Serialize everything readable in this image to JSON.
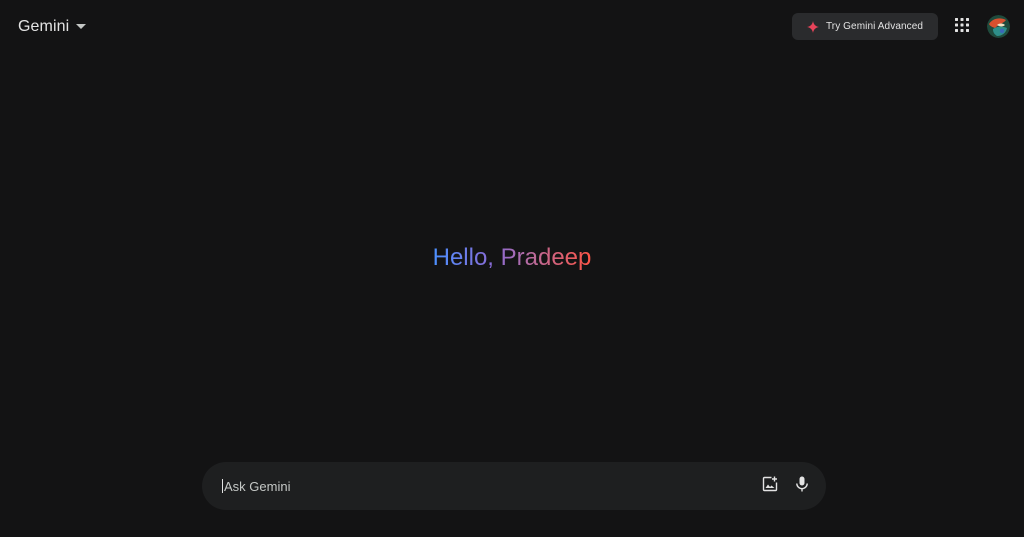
{
  "header": {
    "brand_title": "Gemini",
    "advanced_button_label": "Try Gemini Advanced",
    "icons": {
      "brand_caret": "caret-down-icon",
      "advanced": "sparkle-icon",
      "apps": "apps-grid-icon",
      "avatar": "avatar"
    }
  },
  "main": {
    "greeting": "Hello, Pradeep"
  },
  "prompt": {
    "placeholder": "Ask Gemini",
    "value": "",
    "icons": {
      "image_upload": "add-image-icon",
      "voice": "microphone-icon"
    }
  },
  "colors": {
    "background": "#131314",
    "surface": "#1e1f20",
    "button_surface": "#2a2b2d",
    "text": "#e3e3e3",
    "greeting_gradient_start": "#4b90ff",
    "greeting_gradient_end": "#ff5546",
    "sparkle": "#e8445a"
  }
}
